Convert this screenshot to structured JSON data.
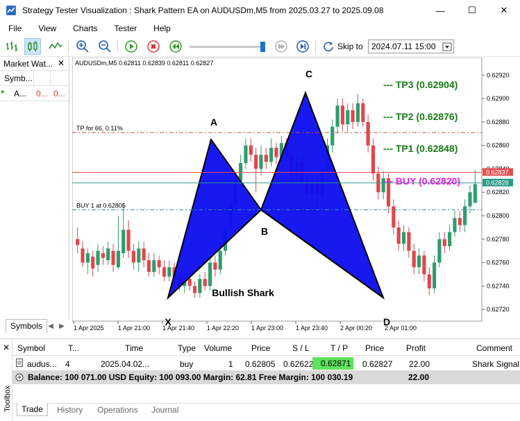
{
  "window": {
    "title": "Strategy Tester Visualization : Shark Pattern EA on AUDUSDm,M5 from 2025.03.27 to 2025.09.08",
    "minimize": "—",
    "maximize": "☐",
    "close": "✕"
  },
  "menu": [
    "File",
    "View",
    "Charts",
    "Tester",
    "Help"
  ],
  "toolbar": {
    "skip_label": "Skip to",
    "skip_value": "2024.07.11 15:00",
    "slider_position": 0.95
  },
  "market_watch": {
    "title": "Market Wat...",
    "close": "✕",
    "columns": [
      "Symb...",
      "",
      ""
    ],
    "row": {
      "symbol": "A...",
      "bid": "0...",
      "ask": "0..."
    },
    "tab": "Symbols"
  },
  "chart": {
    "header": "AUDUSDm,M5  0.62811 0.62839 0.62811 0.62827",
    "tp_line_label": "TP for 66, 0.11%",
    "buy_line_label": "BUY 1 at 0.62805",
    "point_labels": {
      "X": "X",
      "A": "A",
      "B": "B",
      "C": "C",
      "D": "D"
    },
    "pattern_label": "Bullish Shark",
    "annotations": [
      {
        "text": "TP3 (0.62904)",
        "prefix": "---",
        "color": "#1a7a1a"
      },
      {
        "text": "TP2 (0.62876)",
        "prefix": "---",
        "color": "#1a7a1a"
      },
      {
        "text": "TP1 (0.62848)",
        "prefix": "---",
        "color": "#1a7a1a"
      },
      {
        "text": "BUY (0.62820)",
        "prefix": "---",
        "color": "#e21ee2"
      }
    ],
    "price_ticks": [
      "0.62920",
      "0.62900",
      "0.62880",
      "0.62860",
      "0.62840",
      "0.62820",
      "0.62800",
      "0.62780",
      "0.62760",
      "0.62740",
      "0.62720"
    ],
    "price_tags": [
      {
        "text": "0.62837",
        "color": "#e05050"
      },
      {
        "text": "0.62828",
        "color": "#2a9a8a"
      }
    ],
    "time_ticks": [
      "1 Apr 2025",
      "1 Apr 21:00",
      "1 Apr 21:40",
      "1 Apr 22:20",
      "1 Apr 23:00",
      "1 Apr 23:40",
      "2 Apr 00:20",
      "2 Apr 01:00"
    ],
    "colors": {
      "bull": "#2e9c6e",
      "bear": "#e0464b",
      "triangle": "#0c0cf0"
    }
  },
  "chart_data": {
    "type": "candlestick",
    "symbol": "AUDUSDm",
    "timeframe": "M5",
    "ohlc_last": {
      "open": 0.62811,
      "high": 0.62839,
      "low": 0.62811,
      "close": 0.62827
    },
    "ylim": [
      0.6271,
      0.62935
    ],
    "pattern": {
      "name": "Bullish Shark",
      "points": [
        {
          "label": "X",
          "price": 0.6273
        },
        {
          "label": "A",
          "price": 0.62865
        },
        {
          "label": "B",
          "price": 0.62805
        },
        {
          "label": "C",
          "price": 0.62905
        },
        {
          "label": "D",
          "price": 0.6273
        }
      ]
    },
    "levels": {
      "tp3": 0.62904,
      "tp2": 0.62876,
      "tp1": 0.62848,
      "buy": 0.6282,
      "tp_line": 0.62871,
      "buy_line": 0.62805,
      "red_line": 0.62837,
      "teal_line": 0.62828
    },
    "candles": [
      [
        0.6278,
        0.62775,
        0.6279,
        0.62768
      ],
      [
        0.62772,
        0.6276,
        0.62778,
        0.62756
      ],
      [
        0.6276,
        0.62768,
        0.62772,
        0.6275
      ],
      [
        0.62765,
        0.62755,
        0.6277,
        0.62748
      ],
      [
        0.62758,
        0.6277,
        0.62776,
        0.62752
      ],
      [
        0.62768,
        0.62764,
        0.62774,
        0.62758
      ],
      [
        0.62762,
        0.62772,
        0.62778,
        0.62758
      ],
      [
        0.6277,
        0.62758,
        0.62776,
        0.62752
      ],
      [
        0.62756,
        0.6277,
        0.628,
        0.62754
      ],
      [
        0.62768,
        0.62788,
        0.6281,
        0.62764
      ],
      [
        0.62788,
        0.6277,
        0.62796,
        0.62764
      ],
      [
        0.6277,
        0.6276,
        0.62776,
        0.62754
      ],
      [
        0.6276,
        0.62772,
        0.62778,
        0.62752
      ],
      [
        0.62772,
        0.62762,
        0.62778,
        0.62756
      ],
      [
        0.62762,
        0.62752,
        0.62768,
        0.62748
      ],
      [
        0.62752,
        0.62762,
        0.62768,
        0.62748
      ],
      [
        0.62762,
        0.62756,
        0.62766,
        0.6275
      ],
      [
        0.62756,
        0.62748,
        0.62762,
        0.62744
      ],
      [
        0.62748,
        0.62756,
        0.62762,
        0.62744
      ],
      [
        0.62756,
        0.62746,
        0.6276,
        0.6274
      ],
      [
        0.62746,
        0.6274,
        0.62752,
        0.62736
      ],
      [
        0.6274,
        0.62746,
        0.6275,
        0.62734
      ],
      [
        0.62746,
        0.6274,
        0.62752,
        0.62736
      ],
      [
        0.6274,
        0.62734,
        0.62744,
        0.6273
      ],
      [
        0.62734,
        0.62746,
        0.6275,
        0.6273
      ],
      [
        0.62746,
        0.6274,
        0.62752,
        0.62736
      ],
      [
        0.6274,
        0.6276,
        0.62764,
        0.62736
      ],
      [
        0.6276,
        0.62754,
        0.62766,
        0.62748
      ],
      [
        0.62754,
        0.6277,
        0.62776,
        0.6275
      ],
      [
        0.6277,
        0.6279,
        0.62796,
        0.62766
      ],
      [
        0.6279,
        0.6281,
        0.62818,
        0.62786
      ],
      [
        0.6281,
        0.6283,
        0.62836,
        0.62804
      ],
      [
        0.6283,
        0.62845,
        0.62852,
        0.62824
      ],
      [
        0.62845,
        0.6286,
        0.62866,
        0.6284
      ],
      [
        0.6286,
        0.62852,
        0.62866,
        0.62846
      ],
      [
        0.62852,
        0.6284,
        0.62858,
        0.6282
      ],
      [
        0.6284,
        0.62852,
        0.6286,
        0.62834
      ],
      [
        0.62852,
        0.62846,
        0.62858,
        0.6284
      ],
      [
        0.62846,
        0.62858,
        0.62866,
        0.62842
      ],
      [
        0.62858,
        0.6285,
        0.62862,
        0.62844
      ],
      [
        0.6285,
        0.62862,
        0.62868,
        0.62846
      ],
      [
        0.62862,
        0.62852,
        0.62866,
        0.62846
      ],
      [
        0.62852,
        0.62834,
        0.62858,
        0.62828
      ],
      [
        0.62834,
        0.62846,
        0.62852,
        0.6283
      ],
      [
        0.62846,
        0.6283,
        0.6285,
        0.62824
      ],
      [
        0.6283,
        0.62818,
        0.62836,
        0.6281
      ],
      [
        0.62818,
        0.62828,
        0.62834,
        0.62814
      ],
      [
        0.62828,
        0.62818,
        0.62834,
        0.62806
      ],
      [
        0.62818,
        0.6284,
        0.62846,
        0.62814
      ],
      [
        0.6284,
        0.6286,
        0.62866,
        0.62836
      ],
      [
        0.6286,
        0.62876,
        0.62882,
        0.62854
      ],
      [
        0.62876,
        0.62894,
        0.629,
        0.6287
      ],
      [
        0.62894,
        0.62878,
        0.629,
        0.62872
      ],
      [
        0.62878,
        0.6289,
        0.62896,
        0.62872
      ],
      [
        0.6289,
        0.6288,
        0.62896,
        0.62874
      ],
      [
        0.6288,
        0.62896,
        0.62904,
        0.62876
      ],
      [
        0.62896,
        0.6288,
        0.629,
        0.62876
      ],
      [
        0.6288,
        0.6286,
        0.62886,
        0.62854
      ],
      [
        0.6286,
        0.62836,
        0.62866,
        0.6283
      ],
      [
        0.62836,
        0.6282,
        0.62842,
        0.62814
      ],
      [
        0.6282,
        0.62832,
        0.62838,
        0.62814
      ],
      [
        0.62832,
        0.62808,
        0.62836,
        0.62802
      ],
      [
        0.62808,
        0.6279,
        0.62814,
        0.62784
      ],
      [
        0.6279,
        0.62776,
        0.62796,
        0.6277
      ],
      [
        0.62776,
        0.62786,
        0.62792,
        0.6277
      ],
      [
        0.62786,
        0.6277,
        0.6279,
        0.62764
      ],
      [
        0.6277,
        0.62756,
        0.62776,
        0.6275
      ],
      [
        0.62756,
        0.62766,
        0.62772,
        0.6275
      ],
      [
        0.62766,
        0.6275,
        0.6277,
        0.62744
      ],
      [
        0.6275,
        0.62738,
        0.62756,
        0.62732
      ],
      [
        0.62738,
        0.6276,
        0.62766,
        0.62734
      ],
      [
        0.6276,
        0.6278,
        0.62786,
        0.62756
      ],
      [
        0.6278,
        0.62774,
        0.62786,
        0.62768
      ],
      [
        0.62774,
        0.62786,
        0.62792,
        0.6277
      ],
      [
        0.62786,
        0.62798,
        0.62804,
        0.62782
      ],
      [
        0.62798,
        0.62792,
        0.62804,
        0.62786
      ],
      [
        0.62792,
        0.62808,
        0.62814,
        0.62786
      ],
      [
        0.62808,
        0.6282,
        0.62826,
        0.62802
      ],
      [
        0.62811,
        0.62827,
        0.62839,
        0.62811
      ]
    ]
  },
  "terminal": {
    "columns": [
      "Symbol",
      "T...",
      "Time",
      "Type",
      "Volume",
      "Price",
      "S / L",
      "T / P",
      "Price",
      "Profit",
      "Comment"
    ],
    "row": [
      "audus...",
      "4",
      "2025.04.02...",
      "buy",
      "1",
      "0.62805",
      "0.62622",
      "0.62871",
      "0.62827",
      "22.00",
      "Shark Signal"
    ],
    "balance": "Balance: 100 071.00 USD  Equity: 100 093.00  Margin: 62.81  Free Margin: 100 030.19",
    "balance_profit": "22.00",
    "side_label": "Toolbox",
    "tabs": [
      "Trade",
      "History",
      "Operations",
      "Journal"
    ]
  }
}
